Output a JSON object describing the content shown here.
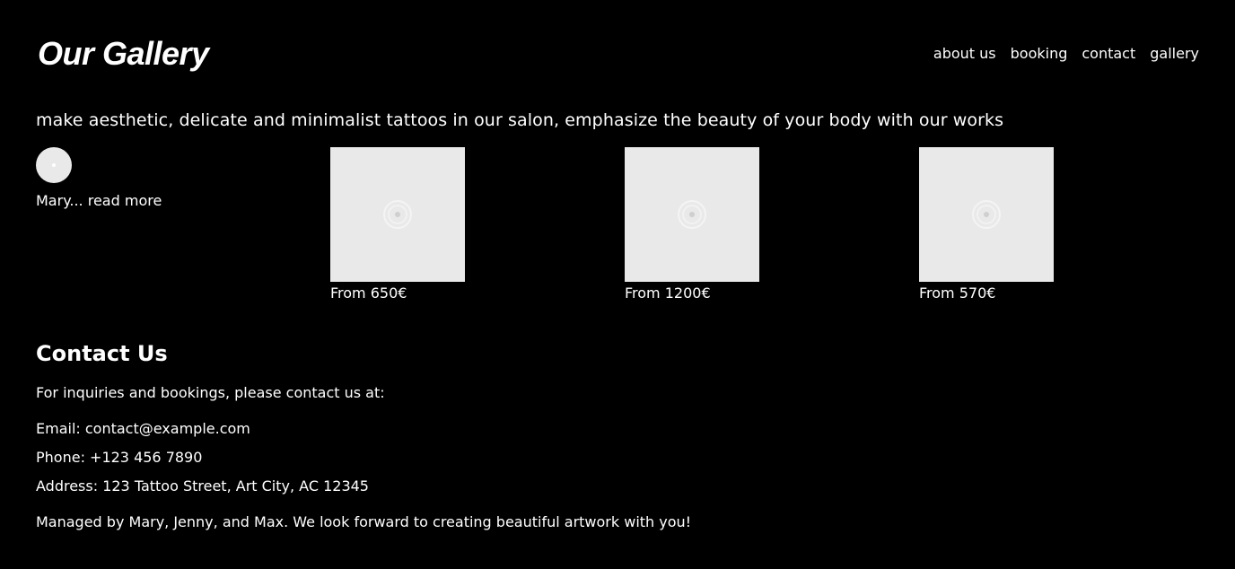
{
  "header": {
    "title": "Our Gallery",
    "nav": [
      "about us",
      "booking",
      "contact",
      "gallery"
    ]
  },
  "tagline": "make aesthetic, delicate and minimalist tattoos in our salon, emphasize the beauty of your body with our works",
  "profile": {
    "name": "Mary...",
    "read_more": "read more"
  },
  "gallery": [
    {
      "price": "From 650€",
      "icon": "image-placeholder-icon"
    },
    {
      "price": "From 1200€",
      "icon": "image-placeholder-icon"
    },
    {
      "price": "From 570€",
      "icon": "image-placeholder-icon"
    }
  ],
  "contact": {
    "heading": "Contact Us",
    "intro": "For inquiries and bookings, please contact us at:",
    "email": "Email: contact@example.com",
    "phone": "Phone: +123 456 7890",
    "address": "Address: 123 Tattoo Street, Art City, AC 12345",
    "managed": "Managed by Mary, Jenny, and Max. We look forward to creating beautiful artwork with you!"
  },
  "colors": {
    "background": "#000000",
    "text": "#ffffff",
    "placeholder": "#e9e9e9"
  }
}
